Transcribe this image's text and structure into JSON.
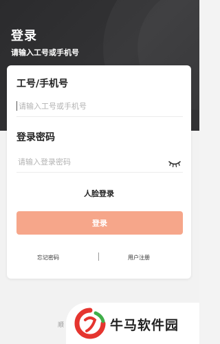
{
  "header": {
    "title": "登录",
    "subtitle": "请输入工号或手机号"
  },
  "form": {
    "account_label": "工号/手机号",
    "account_placeholder": "请输入工号或手机号",
    "account_value": "",
    "password_label": "登录密码",
    "password_placeholder": "请输入登录密码",
    "password_value": "",
    "face_login": "人脸登录",
    "login_button": "登录"
  },
  "links": {
    "forgot_password": "忘记密码",
    "register": "用户注册"
  },
  "footer": {
    "partial_text": "顺"
  },
  "watermark": {
    "text": "牛马软件园"
  },
  "colors": {
    "header_bg": "#2d2d2f",
    "login_button_bg": "#f6a68a",
    "logo_red": "#e5352f",
    "logo_green": "#3fae49"
  },
  "icons": {
    "password_toggle": "eye-closed-icon",
    "watermark_logo": "logo-icon"
  }
}
